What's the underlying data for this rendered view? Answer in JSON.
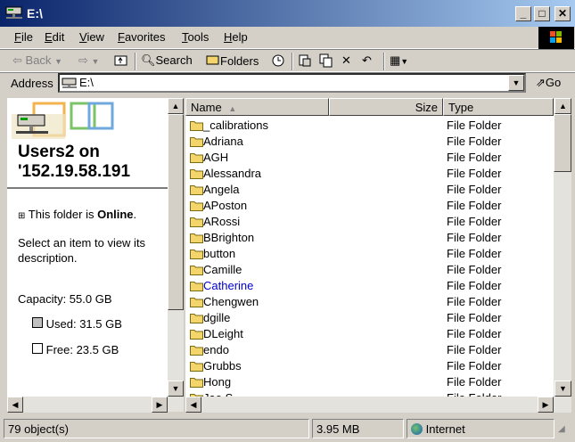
{
  "window": {
    "title": "E:\\"
  },
  "menu": {
    "file": {
      "u": "F",
      "rest": "ile"
    },
    "edit": {
      "u": "E",
      "rest": "dit"
    },
    "view": {
      "u": "V",
      "rest": "iew"
    },
    "favorites": {
      "u": "F",
      "rest": "avorites"
    },
    "tools": {
      "u": "T",
      "rest": "ools"
    },
    "help": {
      "u": "H",
      "rest": "elp"
    }
  },
  "toolbar": {
    "back": "Back",
    "search": "Search",
    "folders": "Folders"
  },
  "address": {
    "label": "Address",
    "value": "E:\\",
    "go": "Go"
  },
  "left_panel": {
    "title_line1": "Users2 on",
    "title_line2": "'152.19.58.191",
    "online_prefix": "This folder is ",
    "online_state": "Online",
    "online_suffix": ".",
    "select_hint_1": "Select an item to view its",
    "select_hint_2": "description.",
    "capacity": "Capacity: 55.0 GB",
    "used": "Used: 31.5 GB",
    "free": "Free: 23.5 GB",
    "used_color": "#c0c0c0",
    "free_color": "#ffffff"
  },
  "columns": {
    "name": "Name",
    "size": "Size",
    "type": "Type"
  },
  "files": [
    {
      "name": "_calibrations",
      "type": "File Folder"
    },
    {
      "name": "Adriana",
      "type": "File Folder"
    },
    {
      "name": "AGH",
      "type": "File Folder"
    },
    {
      "name": "Alessandra",
      "type": "File Folder"
    },
    {
      "name": "Angela",
      "type": "File Folder"
    },
    {
      "name": "APoston",
      "type": "File Folder"
    },
    {
      "name": "ARossi",
      "type": "File Folder"
    },
    {
      "name": "BBrighton",
      "type": "File Folder"
    },
    {
      "name": "button",
      "type": "File Folder"
    },
    {
      "name": "Camille",
      "type": "File Folder"
    },
    {
      "name": "Catherine",
      "type": "File Folder",
      "hover": true
    },
    {
      "name": "Chengwen",
      "type": "File Folder"
    },
    {
      "name": "dgille",
      "type": "File Folder"
    },
    {
      "name": "DLeight",
      "type": "File Folder"
    },
    {
      "name": "endo",
      "type": "File Folder"
    },
    {
      "name": "Grubbs",
      "type": "File Folder"
    },
    {
      "name": "Hong",
      "type": "File Folder"
    },
    {
      "name": "Jae S",
      "type": "File Folder"
    }
  ],
  "status": {
    "objects": "79 object(s)",
    "size": "3.95 MB",
    "zone": "Internet"
  },
  "colors": {
    "title_start": "#0a246a",
    "title_end": "#a6caf0",
    "hover_link": "#0000cc",
    "folder": "#f3d56b"
  }
}
